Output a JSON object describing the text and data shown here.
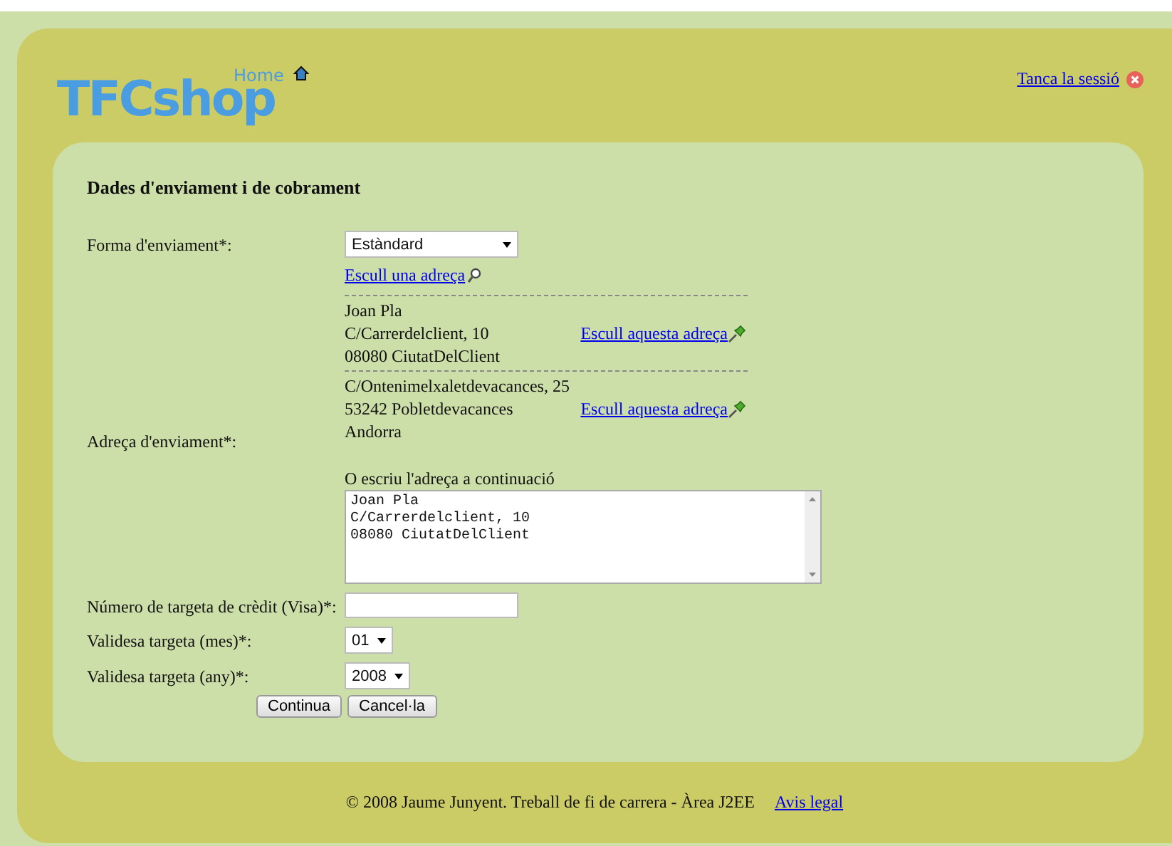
{
  "header": {
    "logo": "TFCshop",
    "home_link": "Home",
    "logout_link": "Tanca la sessió"
  },
  "form": {
    "title": "Dades d'enviament i de cobrament",
    "shipping_method": {
      "label": "Forma d'enviament*:",
      "value": "Estàndard"
    },
    "choose_address_link": "Escull una adreça",
    "address_label": "Adreça d'enviament*:",
    "addresses": [
      {
        "lines": [
          "Joan Pla",
          "C/Carrerdelclient, 10",
          "08080 CiutatDelClient"
        ],
        "link": "Escull aquesta adreça"
      },
      {
        "lines": [
          "C/Ontenimelxaletdevacances, 25",
          "53242 Pobletdevacances",
          "Andorra"
        ],
        "link": "Escull aquesta adreça"
      }
    ],
    "write_address_label": "O escriu l'adreça a continuació",
    "address_text": {
      "lines": [
        "Joan Pla",
        "C/Carrerdelclient, 10",
        "08080 CiutatDelClient"
      ]
    },
    "card_number": {
      "label": "Número de targeta de crèdit (Visa)*:"
    },
    "month": {
      "label": "Validesa targeta (mes)*:",
      "value": "01"
    },
    "year": {
      "label": "Validesa targeta (any)*:",
      "value": "2008"
    },
    "buttons": [
      "Continua",
      "Cancel·la"
    ]
  },
  "footer": {
    "text": "© 2008 Jaume Junyent. Treball de fi de carrera - Àrea J2EE",
    "link": "Avis legal"
  }
}
